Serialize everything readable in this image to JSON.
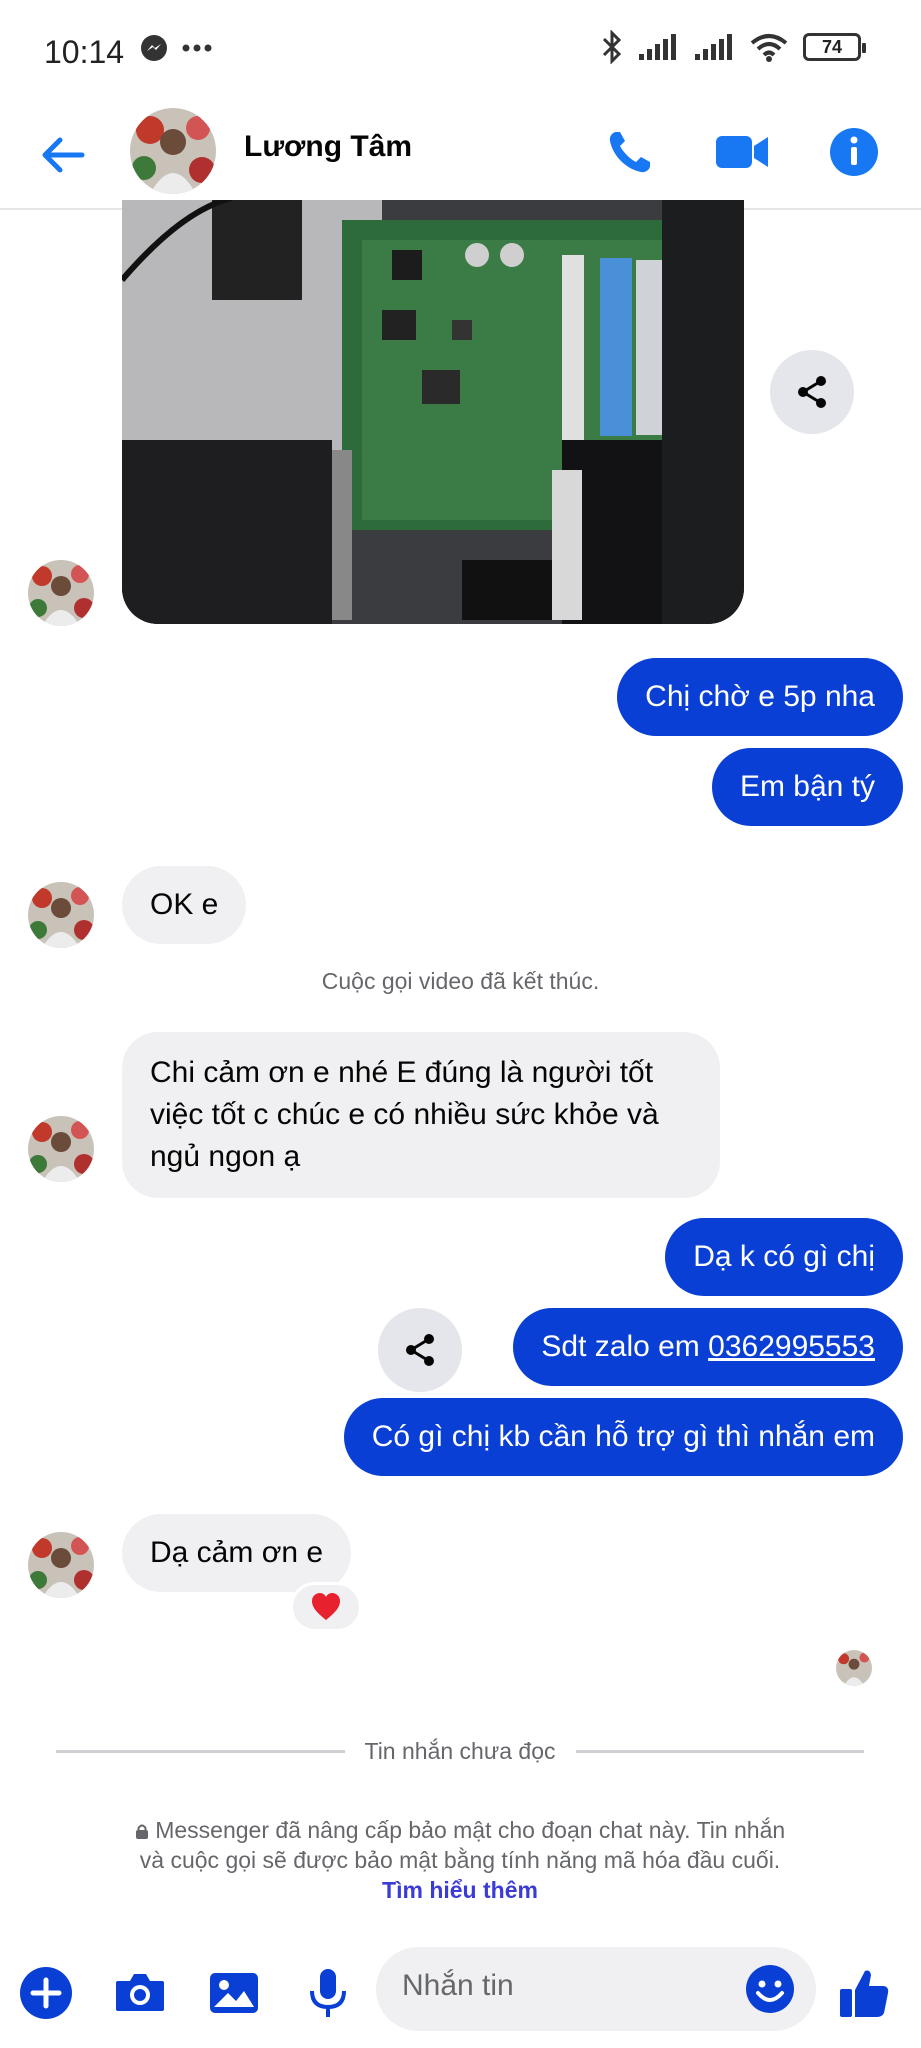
{
  "status_bar": {
    "time": "10:14",
    "battery": "74"
  },
  "header": {
    "contact_name": "Lương Tâm"
  },
  "messages": {
    "out_1": "Chị chờ e 5p nha",
    "out_2": "Em bận tý",
    "in_1": "OK e",
    "call_ended": "Cuộc gọi video đã kết thúc.",
    "in_2": "Chi cảm ơn e nhé E đúng là người tốt việc tốt c chúc e có nhiều sức khỏe và ngủ ngon ạ",
    "out_3": "Dạ k có gì chị",
    "out_4_prefix": "Sdt zalo em ",
    "out_4_phone": "0362995553",
    "out_5": "Có gì chị kb cần hỗ trợ gì thì nhắn em",
    "in_3": "Dạ  cảm ơn e",
    "reaction": "heart"
  },
  "unread_divider": "Tin nhắn chưa đọc",
  "security": {
    "text": "Messenger đã nâng cấp bảo mật cho đoạn chat này. Tin nhắn và cuộc gọi sẽ được bảo mật bằng tính năng mã hóa đầu cuối.",
    "link": "Tìm hiểu thêm"
  },
  "composer": {
    "placeholder": "Nhắn tin"
  },
  "colors": {
    "accent": "#1877f2",
    "outgoing_bubble": "#0a3fd6",
    "incoming_bubble": "#f0f0f2"
  }
}
